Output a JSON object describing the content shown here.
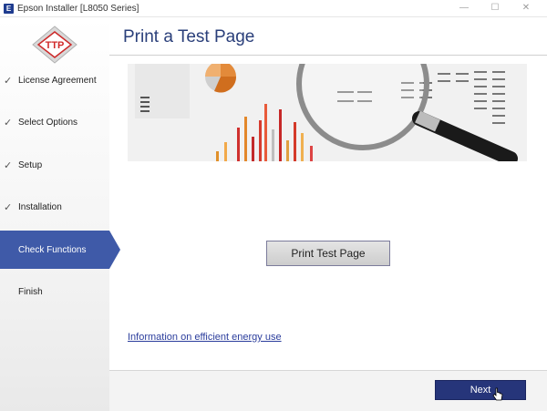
{
  "window": {
    "app_icon": "E",
    "title": "Epson Installer [L8050 Series]",
    "minimize": "—",
    "maximize": "☐",
    "close": "✕"
  },
  "sidebar": {
    "logo_text": "TTP",
    "steps": [
      {
        "label": "License Agreement",
        "done": true
      },
      {
        "label": "Select Options",
        "done": true
      },
      {
        "label": "Setup",
        "done": true
      },
      {
        "label": "Installation",
        "done": true
      },
      {
        "label": "Check Functions",
        "active": true
      },
      {
        "label": "Finish",
        "done": false
      }
    ],
    "check_glyph": "✓"
  },
  "main": {
    "title": "Print a Test Page",
    "print_button": "Print Test Page",
    "energy_link": "Information on efficient energy use",
    "next_button": "Next"
  },
  "colors": {
    "accent": "#3f5aa8",
    "title": "#2a3f7a",
    "next": "#26357a",
    "link": "#2b3d9c"
  }
}
